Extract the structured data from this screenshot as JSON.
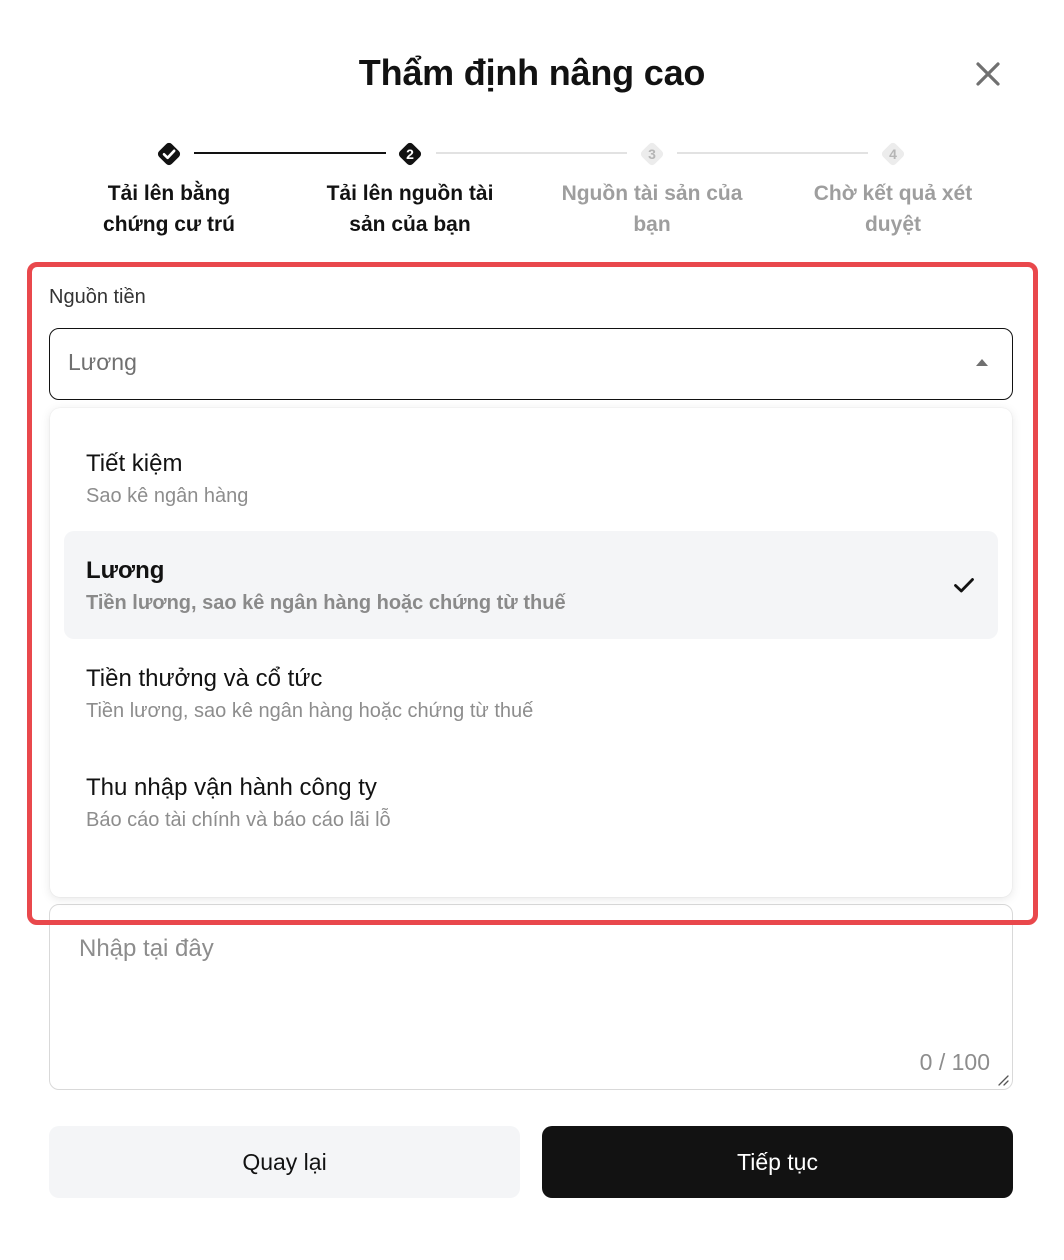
{
  "dialog": {
    "title": "Thẩm định nâng cao"
  },
  "stepper": {
    "steps": [
      {
        "marker": "",
        "label_line1": "Tải lên bằng",
        "label_line2": "chứng cư trú",
        "state": "done"
      },
      {
        "marker": "2",
        "label_line1": "Tải lên nguồn tài",
        "label_line2": "sản của bạn",
        "state": "current"
      },
      {
        "marker": "3",
        "label_line1": "Nguồn tài sản của",
        "label_line2": "bạn",
        "state": "pending"
      },
      {
        "marker": "4",
        "label_line1": "Chờ kết quả xét",
        "label_line2": "duyệt",
        "state": "pending"
      }
    ]
  },
  "source_field": {
    "label": "Nguồn tiền",
    "value": "Lương",
    "options": [
      {
        "title": "Tiết kiệm",
        "description": "Sao kê ngân hàng",
        "selected": false
      },
      {
        "title": "Lương",
        "description": "Tiền lương, sao kê ngân hàng hoặc chứng từ thuế",
        "selected": true
      },
      {
        "title": "Tiền thưởng và cổ tức",
        "description": "Tiền lương, sao kê ngân hàng hoặc chứng từ thuế",
        "selected": false
      },
      {
        "title": "Thu nhập vận hành công ty",
        "description": "Báo cáo tài chính và báo cáo lãi lỗ",
        "selected": false
      }
    ]
  },
  "details_field": {
    "placeholder": "Nhập tại đây",
    "counter": "0 / 100"
  },
  "footer": {
    "back_label": "Quay lại",
    "next_label": "Tiếp tục"
  },
  "colors": {
    "primary": "#121212",
    "highlight": "#e9484c",
    "muted": "#9e9e9e",
    "surface": "#f4f5f7"
  },
  "icons": {
    "close": "close-icon",
    "step_done": "check-diamond-icon",
    "caret": "caret-up-icon",
    "selected_check": "check-icon",
    "resize": "resize-handle-icon"
  }
}
